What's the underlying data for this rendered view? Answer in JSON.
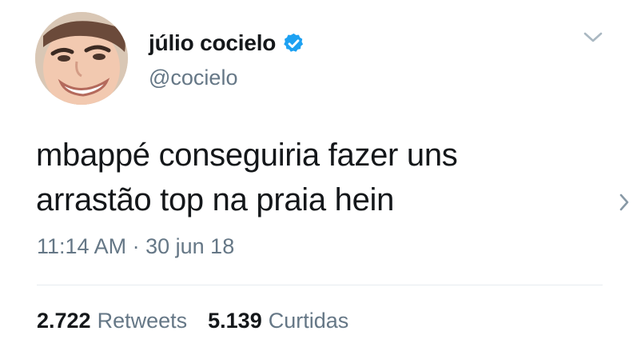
{
  "tweet": {
    "author": {
      "display_name": "júlio cocielo",
      "handle": "@cocielo",
      "verified": true,
      "avatar_icon": "profile-photo"
    },
    "text_lines": [
      "mbappé conseguiria fazer uns",
      "arrastão top na praia hein"
    ],
    "timestamp": {
      "time": "11:14 AM",
      "separator": "·",
      "date": "30 jun 18"
    },
    "stats": {
      "retweets_count": "2.722",
      "retweets_label": "Retweets",
      "likes_count": "5.139",
      "likes_label": "Curtidas"
    },
    "icons": {
      "menu": "chevron-down-icon",
      "next": "chevron-right-icon",
      "verified": "verified-badge-icon"
    },
    "colors": {
      "text": "#14171a",
      "secondary": "#657786",
      "verified_blue": "#1da1f2",
      "divider": "#e6ecf0",
      "caret": "#aab8c2"
    }
  }
}
